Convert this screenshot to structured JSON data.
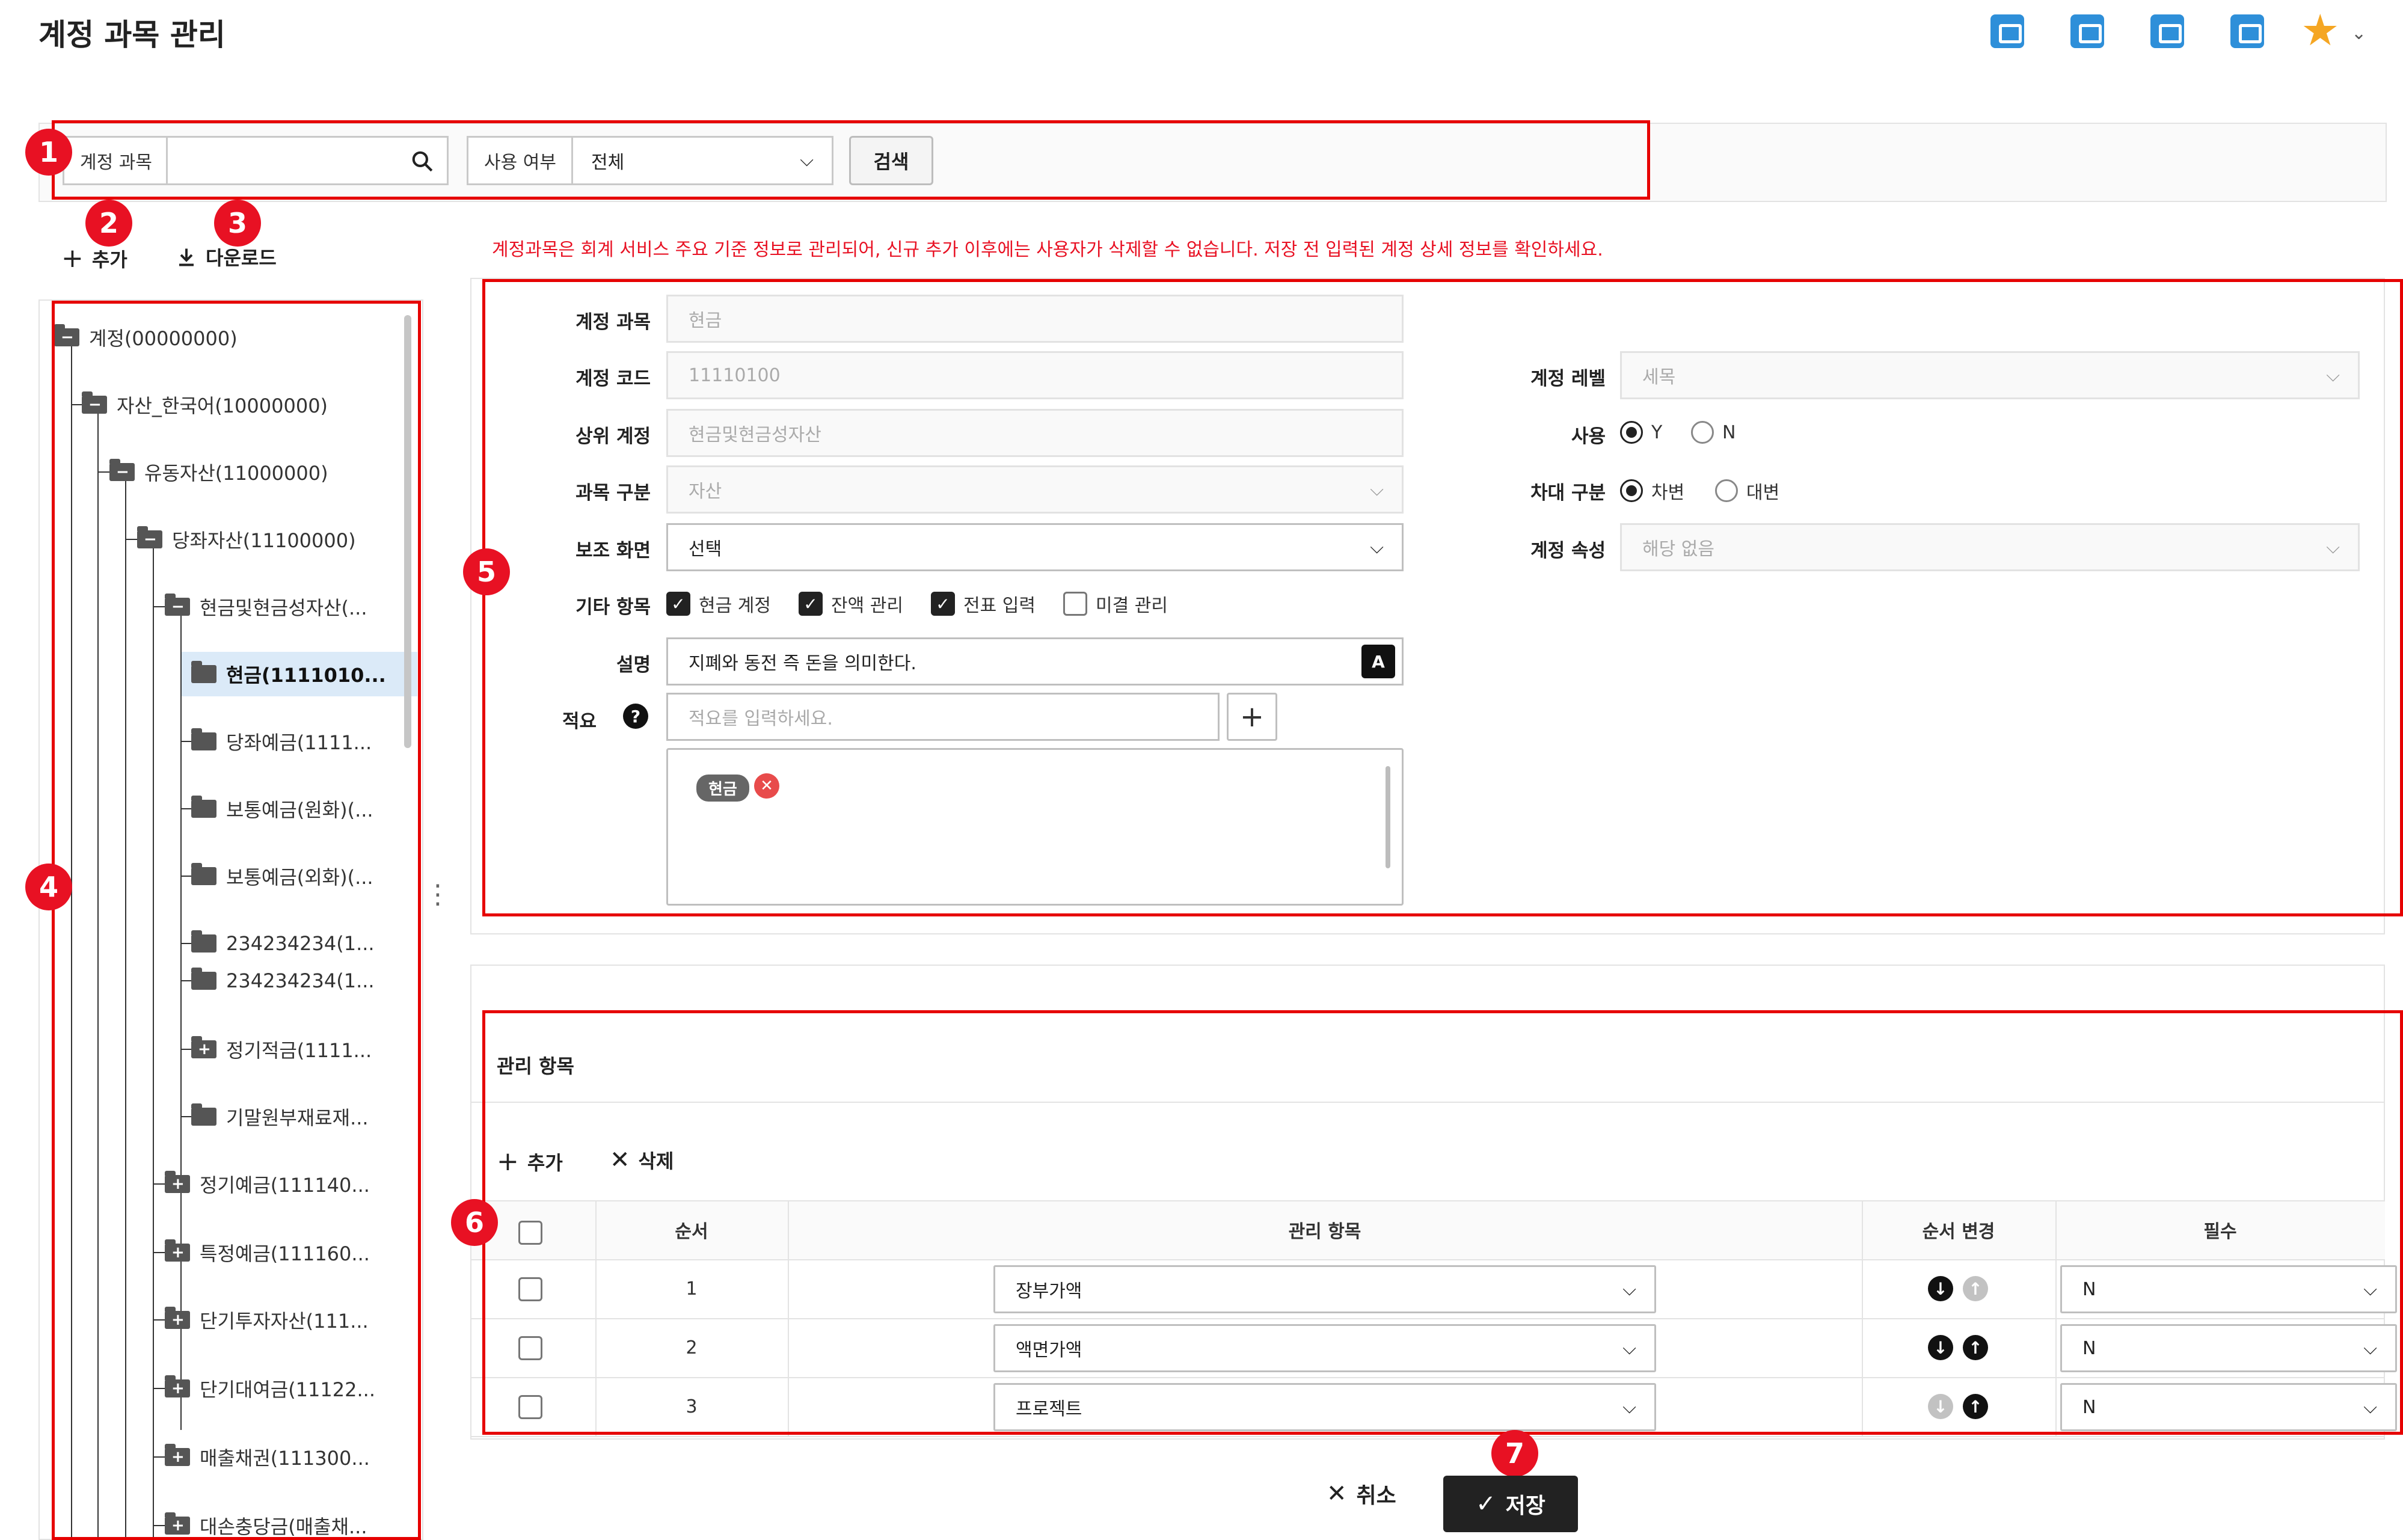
{
  "header": {
    "title": "계정 과목 관리",
    "icons": [
      "user-badge-icon",
      "calendar-icon",
      "announcement-icon",
      "document-list-icon"
    ],
    "favorite_icon": "star-icon"
  },
  "search": {
    "account_label": "계정 과목",
    "account_value": "",
    "use_label": "사용 여부",
    "use_value": "전체",
    "search_button": "검색"
  },
  "toolbar": {
    "add_label": "추가",
    "download_label": "다운로드"
  },
  "notice": "계정과목은 회계 서비스 주요 기준 정보로 관리되어, 신규 추가 이후에는 사용자가 삭제할 수 없습니다. 저장 전 입력된 계정 상세 정보를 확인하세요.",
  "tree": {
    "items": [
      {
        "label": "계정(00000000)",
        "sign": "−"
      },
      {
        "label": "자산_한국어(10000000)",
        "sign": "−"
      },
      {
        "label": "유동자산(11000000)",
        "sign": "−"
      },
      {
        "label": "당좌자산(11100000)",
        "sign": "−"
      },
      {
        "label": "현금및현금성자산(...",
        "sign": "−"
      },
      {
        "label": "현금(1111010...",
        "sign": "",
        "selected": true
      },
      {
        "label": "당좌예금(1111...",
        "sign": ""
      },
      {
        "label": "보통예금(원화)(...",
        "sign": ""
      },
      {
        "label": "보통예금(외화)(...",
        "sign": ""
      },
      {
        "label": "234234234(1...",
        "sign": ""
      },
      {
        "label": "234234234(1...",
        "sign": ""
      },
      {
        "label": "정기적금(1111...",
        "sign": "+"
      },
      {
        "label": "기말원부재료재...",
        "sign": ""
      },
      {
        "label": "정기예금(111140...",
        "sign": "+"
      },
      {
        "label": "특정예금(111160...",
        "sign": "+"
      },
      {
        "label": "단기투자자산(111...",
        "sign": "+"
      },
      {
        "label": "단기대여금(11122...",
        "sign": "+"
      },
      {
        "label": "매출채권(111300...",
        "sign": "+"
      },
      {
        "label": "대손충당금(매출채...",
        "sign": "+"
      }
    ]
  },
  "detail": {
    "account_label": "계정 과목",
    "account_value": "현금",
    "code_label": "계정 코드",
    "code_value": "11110100",
    "parent_label": "상위 계정",
    "parent_value": "현금및현금성자산",
    "category_label": "과목 구분",
    "category_value": "자산",
    "sub_screen_label": "보조 화면",
    "sub_screen_value": "선택",
    "other_label": "기타 항목",
    "other_items": [
      {
        "label": "현금 계정",
        "checked": true
      },
      {
        "label": "잔액 관리",
        "checked": true
      },
      {
        "label": "전표 입력",
        "checked": true
      },
      {
        "label": "미결 관리",
        "checked": false
      }
    ],
    "desc_label": "설명",
    "desc_value": "지폐와 동전 즉 돈을 의미한다.",
    "desc_button": "A",
    "memo_label": "적요",
    "memo_placeholder": "적요를 입력하세요.",
    "memo_tags": [
      "현금"
    ],
    "tag_remove": "✕",
    "level_label": "계정 레벨",
    "level_value": "세목",
    "use_label": "사용",
    "use_y": "Y",
    "use_n": "N",
    "use_selected": "Y",
    "dc_label": "차대 구분",
    "dc_debit": "차변",
    "dc_credit": "대변",
    "dc_selected": "차변",
    "attr_label": "계정 속성",
    "attr_value": "해당 없음"
  },
  "management": {
    "title": "관리 항목",
    "add_label": "추가",
    "delete_label": "삭제",
    "columns": [
      "순서",
      "관리 항목",
      "순서 변경",
      "필수"
    ],
    "rows": [
      {
        "order": "1",
        "item": "장부가액",
        "required": "N",
        "down": true,
        "up": false
      },
      {
        "order": "2",
        "item": "액면가액",
        "required": "N",
        "down": true,
        "up": true
      },
      {
        "order": "3",
        "item": "프로젝트",
        "required": "N",
        "down": false,
        "up": true
      }
    ]
  },
  "footer": {
    "cancel_label": "취소",
    "save_label": "저장"
  },
  "annotations": [
    "1",
    "2",
    "3",
    "4",
    "5",
    "6",
    "7"
  ],
  "colors": {
    "annotation": "#e60000",
    "badge": "#e81123",
    "accent": "#2e8fd9",
    "selected_row": "#dbeaf8"
  }
}
